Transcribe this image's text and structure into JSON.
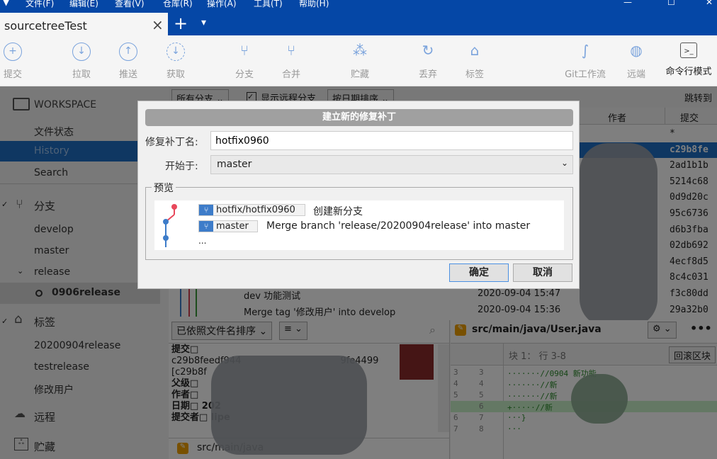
{
  "menu": [
    "文件(F)",
    "编辑(E)",
    "查看(V)",
    "仓库(R)",
    "操作(A)",
    "工具(T)",
    "帮助(H)"
  ],
  "tab": {
    "title": "sourcetreeTest",
    "close": "×",
    "add": "+",
    "dropdown": "▾"
  },
  "toolbar": [
    {
      "label": "提交",
      "icon": "plus-circle-icon",
      "glyph": "+"
    },
    {
      "label": "拉取",
      "icon": "arrow-down-circle-icon",
      "glyph": "↓"
    },
    {
      "label": "推送",
      "icon": "arrow-up-circle-icon",
      "glyph": "↑"
    },
    {
      "label": "获取",
      "icon": "fetch-icon",
      "glyph": "↓"
    },
    {
      "label": "分支",
      "icon": "branch-icon",
      "glyph": "⑂"
    },
    {
      "label": "合并",
      "icon": "merge-icon",
      "glyph": "⑂"
    },
    {
      "label": "贮藏",
      "icon": "stash-icon",
      "glyph": "⁂"
    },
    {
      "label": "丢弃",
      "icon": "discard-icon",
      "glyph": "↻"
    },
    {
      "label": "标签",
      "icon": "tag-icon",
      "glyph": "⌂"
    },
    {
      "label": "Git工作流",
      "icon": "git-flow-icon",
      "glyph": "∫"
    },
    {
      "label": "远端",
      "icon": "globe-warning-icon",
      "glyph": "◍"
    },
    {
      "label": "命令行模式",
      "icon": "terminal-icon",
      "glyph": ">_"
    }
  ],
  "sidebar": {
    "workspace": "WORKSPACE",
    "workspace_items": [
      "文件状态",
      "History",
      "Search"
    ],
    "branches_header": "分支",
    "branches": [
      "develop",
      "master",
      "release"
    ],
    "sub_branch": "0906release",
    "tags_header": "标签",
    "tags": [
      "20200904release",
      "testrelease",
      "修改用户"
    ],
    "remotes_header": "远程",
    "stashes_header": "贮藏"
  },
  "filters": {
    "branches": "所有分支",
    "show_remote": "显示远程分支",
    "sort": "按日期排序",
    "jump": "跳转到"
  },
  "columns": {
    "author": "作者",
    "commit": "提交"
  },
  "commits": [
    {
      "hash": "*"
    },
    {
      "hash": "c29b8fe",
      "selected": true
    },
    {
      "hash": "2ad1b1b"
    },
    {
      "hash": "5214c68"
    },
    {
      "hash": "0d9d20c"
    },
    {
      "hash": "95c6736"
    },
    {
      "hash": "d6b3fba"
    },
    {
      "hash": "02db692"
    },
    {
      "hash": "4ecf8d5"
    },
    {
      "hash": "8c4c031"
    },
    {
      "hash": "f3c80dd",
      "desc": "dev 功能测试",
      "date": "2020-09-04 15:47"
    },
    {
      "hash": "29a32b0",
      "desc": "Merge tag '修改用户' into develop",
      "date": "2020-09-04 15:36"
    }
  ],
  "file_pane": {
    "sort": "已依照文件名排序",
    "view": "≡",
    "details": [
      "提交□",
      "c29b8feedf944",
      "9fe4499",
      "[c29b8f",
      "父级□",
      "作者□",
      "日期□ 202",
      "提交者□ lipe"
    ],
    "file": "src/main/java"
  },
  "diff_pane": {
    "file": "src/main/java/User.java",
    "hunk": "块 1： 行 3-8",
    "revert": "回滚区块",
    "lines": [
      {
        "old": "3",
        "new": "3",
        "text": "·······//0904 新功能",
        "type": "ctx"
      },
      {
        "old": "4",
        "new": "4",
        "text": "·······//新",
        "type": "ctx"
      },
      {
        "old": "5",
        "new": "5",
        "text": "·······//新",
        "type": "ctx"
      },
      {
        "old": "",
        "new": "6",
        "text": "+·····//新",
        "type": "add"
      },
      {
        "old": "6",
        "new": "7",
        "text": "···}",
        "type": "ctx"
      },
      {
        "old": "7",
        "new": "8",
        "text": "···",
        "type": "ctx"
      }
    ]
  },
  "dialog": {
    "title": "建立新的修复补丁",
    "name_label": "修复补丁名:",
    "name_value": "hotfix0960",
    "start_label": "开始于:",
    "start_value": "master",
    "preview_label": "预览",
    "preview": [
      {
        "branch": "hotfix/hotfix0960",
        "msg": "创建新分支"
      },
      {
        "branch": "master",
        "msg": "Merge branch 'release/20200904release' into master"
      }
    ],
    "ellipsis": "...",
    "ok": "确定",
    "cancel": "取消"
  },
  "colors": {
    "titlebar": "#0547a6",
    "selection": "#1f6fc5",
    "accent": "#3d7cc9",
    "new_branch_dot": "#e8485b"
  }
}
